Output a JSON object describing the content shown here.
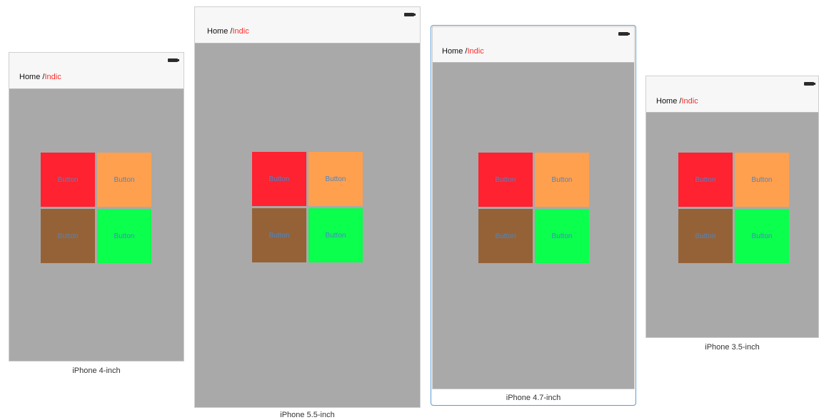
{
  "breadcrumb": {
    "home": "Home /",
    "current": "Indic"
  },
  "tiles": [
    {
      "label": "Button",
      "color": "#ff2230"
    },
    {
      "label": "Button",
      "color": "#ffa04f"
    },
    {
      "label": "Button",
      "color": "#956237"
    },
    {
      "label": "Button",
      "color": "#0bff4d"
    }
  ],
  "devices": [
    {
      "name": "iPhone 4-inch"
    },
    {
      "name": "iPhone 5.5-inch"
    },
    {
      "name": "iPhone 4.7-inch",
      "selected": true
    },
    {
      "name": "iPhone 3.5-inch"
    }
  ],
  "colors": {
    "canvas_background": "#ffffff",
    "device_background": "#a9a9a9",
    "nav_bar": "#f7f7f7",
    "breadcrumb_current": "#ff2a2a",
    "button_text": "#4a86c8",
    "selection_border": "#5b9bd5"
  }
}
